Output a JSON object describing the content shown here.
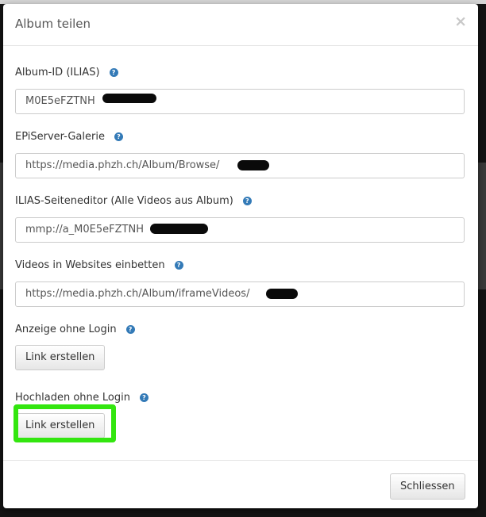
{
  "dialog": {
    "title": "Album teilen",
    "close_glyph": "×",
    "fields": [
      {
        "label": "Album-ID (ILIAS)",
        "value": "M0E5eFZTNH",
        "help_icon": "question-circle-icon"
      },
      {
        "label": "EPiServer-Galerie",
        "value": "https://media.phzh.ch/Album/Browse/",
        "help_icon": "question-circle-icon"
      },
      {
        "label": "ILIAS-Seiteneditor (Alle Videos aus Album)",
        "value": "mmp://a_M0E5eFZTNH",
        "help_icon": "question-circle-icon"
      },
      {
        "label": "Videos in Websites einbetten",
        "value": "https://media.phzh.ch/Album/iframeVideos/",
        "help_icon": "question-circle-icon"
      }
    ],
    "sections": [
      {
        "label": "Anzeige ohne Login",
        "button": "Link erstellen",
        "help_icon": "question-circle-icon"
      },
      {
        "label": "Hochladen ohne Login",
        "button": "Link erstellen",
        "help_icon": "question-circle-icon"
      }
    ],
    "footer": {
      "close_button": "Schliessen"
    },
    "colors": {
      "help_icon": "#337ab7",
      "highlight": "#33e60f",
      "redaction": "#0a0a0a"
    }
  }
}
